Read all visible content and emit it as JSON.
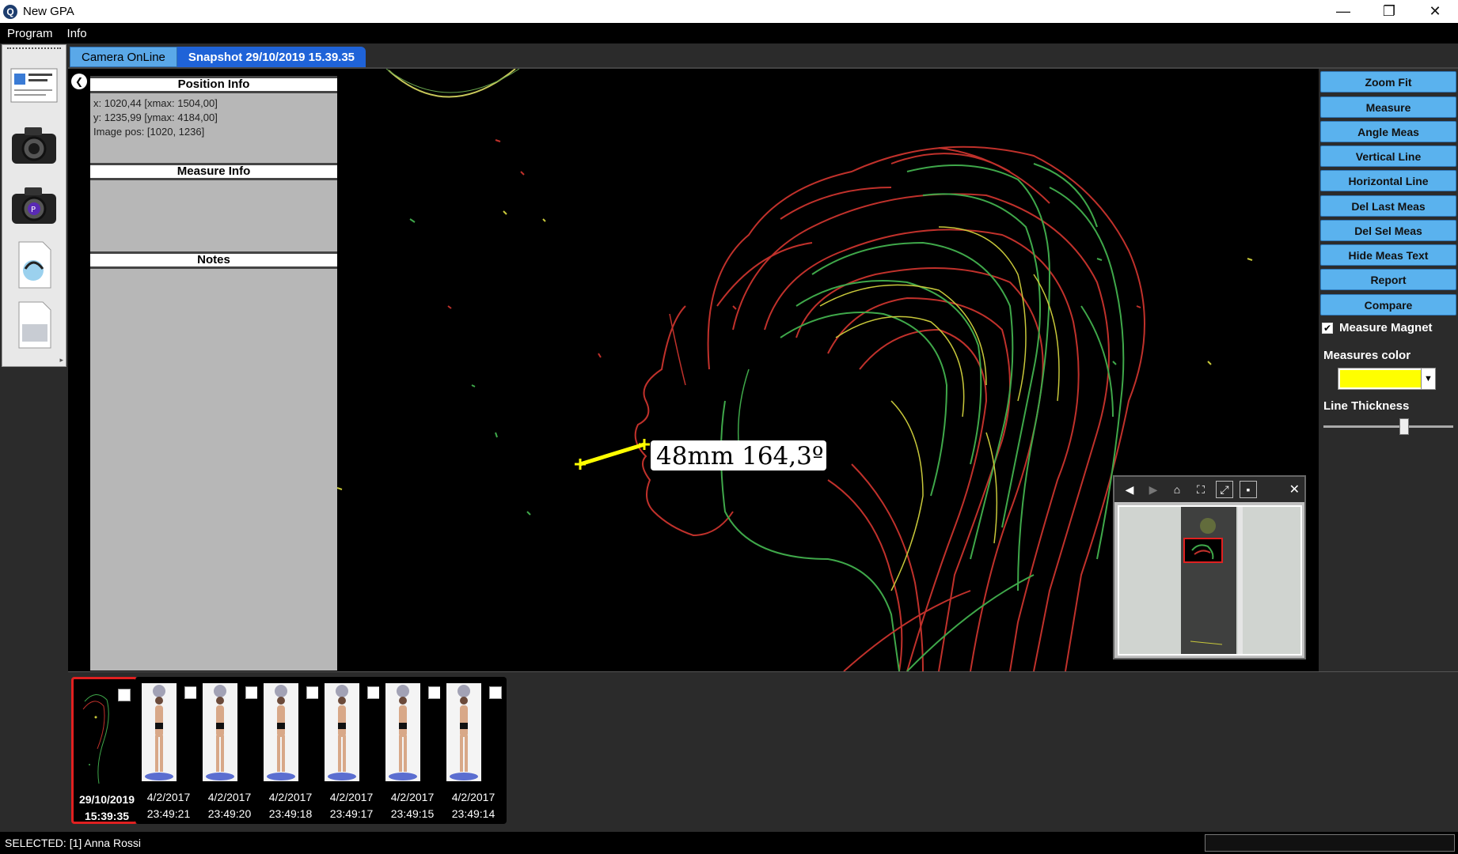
{
  "window": {
    "title": "New GPA",
    "icon_name": "app-logo-icon",
    "controls": [
      "minimize-icon",
      "restore-icon",
      "close-icon"
    ]
  },
  "menu": {
    "items": [
      "Program",
      "Info"
    ]
  },
  "toolstrip": {
    "tools": [
      "patient-card-icon",
      "camera-icon",
      "camera-p-icon",
      "document-scan-icon",
      "document-blank-icon"
    ]
  },
  "tabs": [
    {
      "label": "Camera OnLine",
      "active": false
    },
    {
      "label": "Snapshot 29/10/2019 15.39.35",
      "active": true
    }
  ],
  "info_panel": {
    "position_header": "Position Info",
    "position_lines": [
      "x: 1020,44 [xmax: 1504,00]",
      "y: 1235,99 [ymax: 4184,00]",
      "Image pos: [1020, 1236]"
    ],
    "measure_header": "Measure Info",
    "notes_header": "Notes"
  },
  "canvas": {
    "measure_label": "48mm  164,3º",
    "measure_color": "#ffff00"
  },
  "right_panel": {
    "buttons": [
      "Zoom Fit",
      "Measure",
      "Angle Meas",
      "Vertical Line",
      "Horizontal Line",
      "Del Last Meas",
      "Del Sel Meas",
      "Hide Meas Text",
      "Report",
      "Compare"
    ],
    "magnet_label": "Measure Magnet",
    "magnet_checked": true,
    "color_label": "Measures color",
    "color_value": "#ffff00",
    "thickness_label": "Line Thickness",
    "thickness_level": 0.62
  },
  "navigator": {
    "tools": [
      "prev-arrow-icon",
      "next-arrow-icon",
      "home-icon",
      "fit-icon",
      "expand-icon",
      "stop-icon"
    ],
    "close_icon": "close-icon"
  },
  "thumbnails": [
    {
      "date": "29/10/2019",
      "time": "15:39:35",
      "selected": true
    },
    {
      "date": "4/2/2017",
      "time": "23:49:21",
      "selected": false
    },
    {
      "date": "4/2/2017",
      "time": "23:49:20",
      "selected": false
    },
    {
      "date": "4/2/2017",
      "time": "23:49:18",
      "selected": false
    },
    {
      "date": "4/2/2017",
      "time": "23:49:17",
      "selected": false
    },
    {
      "date": "4/2/2017",
      "time": "23:49:15",
      "selected": false
    },
    {
      "date": "4/2/2017",
      "time": "23:49:14",
      "selected": false
    }
  ],
  "status": {
    "text": "SELECTED: [1] Anna Rossi"
  }
}
